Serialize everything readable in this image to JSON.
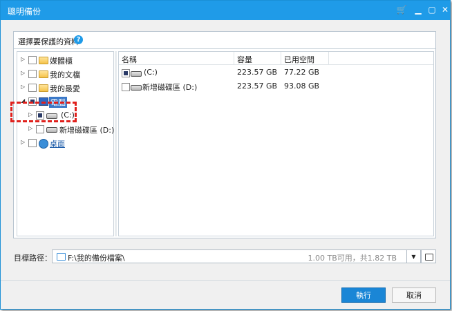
{
  "window": {
    "title": "聰明備份"
  },
  "panel": {
    "title": "選擇要保護的資料"
  },
  "tree": {
    "items": [
      {
        "label": "媒體櫃"
      },
      {
        "label": "我的文檔"
      },
      {
        "label": "我的最愛"
      },
      {
        "label": "電腦"
      },
      {
        "label": "(C:)"
      },
      {
        "label": "新增磁碟區 (D:)"
      },
      {
        "label": "桌面"
      }
    ]
  },
  "list": {
    "columns": [
      "名稱",
      "容量",
      "已用空間"
    ],
    "rows": [
      {
        "name": "(C:)",
        "capacity": "223.57 GB",
        "used": "77.22 GB"
      },
      {
        "name": "新增磁碟區 (D:)",
        "capacity": "223.57 GB",
        "used": "93.08 GB"
      }
    ]
  },
  "destination": {
    "label": "目標路徑：",
    "path": "F:\\我的備份檔案\\",
    "space": "1.00 TB可用，共1.82 TB"
  },
  "buttons": {
    "execute": "執行",
    "cancel": "取消"
  }
}
